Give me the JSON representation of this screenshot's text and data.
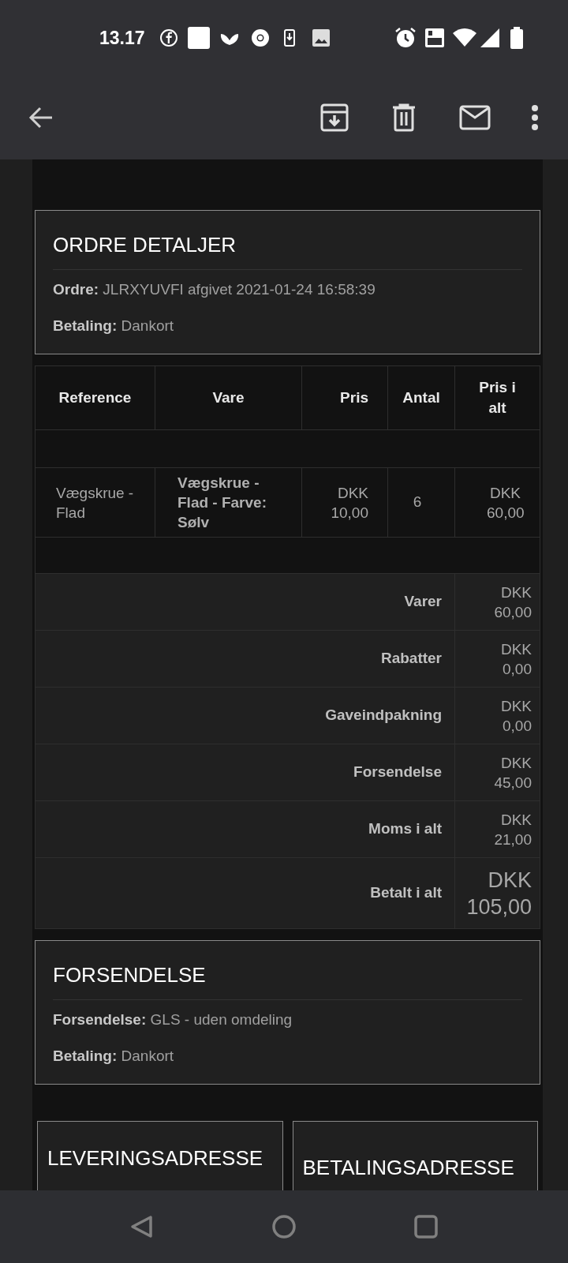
{
  "status_bar": {
    "time": "13.17"
  },
  "email": {
    "order_details": {
      "title": "ORDRE DETALJER",
      "lines": [
        {
          "label": "Ordre:",
          "value": "JLRXYUVFI afgivet 2021-01-24 16:58:39"
        },
        {
          "label": "Betaling:",
          "value": "Dankort"
        }
      ]
    },
    "table": {
      "columns": [
        "Reference",
        "Vare",
        "Pris",
        "Antal",
        "Pris i alt"
      ],
      "rows": [
        {
          "reference": "Vægskrue - Flad",
          "item": "Vægskrue - Flad - Farve: Sølv",
          "price": "DKK 10,00",
          "quantity": "6",
          "total": "DKK 60,00"
        }
      ]
    },
    "totals": [
      {
        "kind": "line",
        "label": "Varer",
        "value": "DKK 60,00"
      },
      {
        "kind": "line",
        "label": "Rabatter",
        "value": "DKK 0,00"
      },
      {
        "kind": "line",
        "label": "Gaveindpakning",
        "value": "DKK 0,00"
      },
      {
        "kind": "line",
        "label": "Forsendelse",
        "value": "DKK 45,00"
      },
      {
        "kind": "line",
        "label": "Moms i alt",
        "value": "DKK 21,00"
      },
      {
        "kind": "grand",
        "label": "Betalt i alt",
        "value": "DKK 105,00"
      }
    ],
    "shipping": {
      "title": "FORSENDELSE",
      "lines": [
        {
          "label": "Forsendelse:",
          "value": "GLS - uden omdeling"
        },
        {
          "label": "Betaling:",
          "value": "Dankort"
        }
      ]
    },
    "address_cards": [
      {
        "title": "LEVERINGSADRESSE"
      },
      {
        "title": "BETALINGSADRESSE"
      }
    ]
  }
}
